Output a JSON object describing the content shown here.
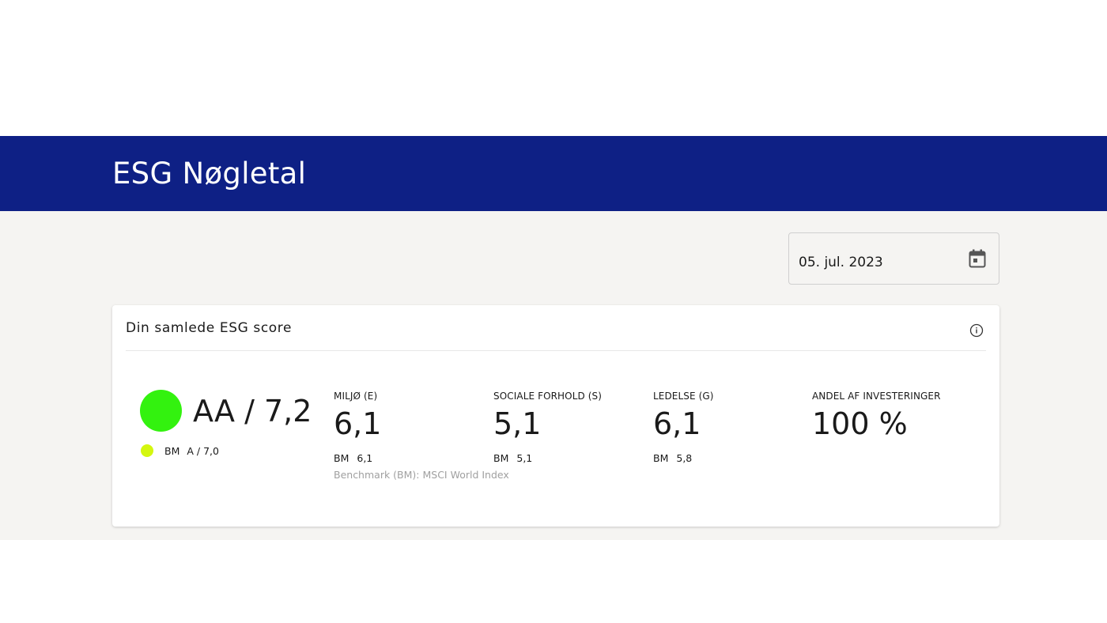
{
  "header": {
    "title": "ESG Nøgletal"
  },
  "date_picker": {
    "value": "05. jul. 2023",
    "icon": "calendar-icon"
  },
  "card": {
    "title": "Din samlede ESG score",
    "info_icon": "info-icon",
    "overall": {
      "score": "AA / 7,2",
      "color": "#33f20f",
      "bm_label": "BM",
      "bm_value": "A / 7,0",
      "bm_color": "#d4f70f"
    },
    "metrics": [
      {
        "label": "MILJØ (E)",
        "value": "6,1",
        "bm_label": "BM",
        "bm_value": "6,1"
      },
      {
        "label": "SOCIALE FORHOLD (S)",
        "value": "5,1",
        "bm_label": "BM",
        "bm_value": "5,1"
      },
      {
        "label": "LEDELSE (G)",
        "value": "6,1",
        "bm_label": "BM",
        "bm_value": "5,8"
      },
      {
        "label": "ANDEL AF INVESTERINGER",
        "value": "100 %"
      }
    ],
    "benchmark_note": "Benchmark (BM): MSCI World Index"
  },
  "colors": {
    "header_bg": "#0e2085",
    "page_bg": "#f5f4f2"
  }
}
